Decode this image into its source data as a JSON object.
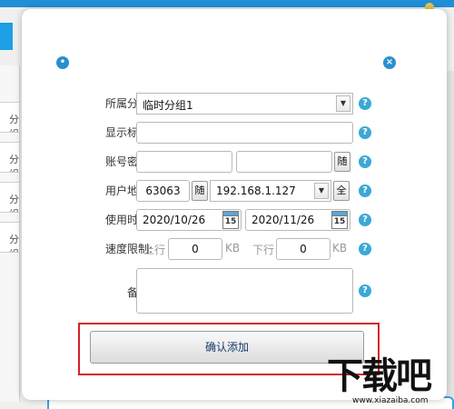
{
  "background": {
    "left_items": [
      "分组",
      "分组",
      "分组",
      "分组"
    ]
  },
  "dialog": {
    "group": {
      "label": "所属分组:",
      "value": "临时分组1"
    },
    "title_field": {
      "label": "显示标题:",
      "value": ""
    },
    "account": {
      "label": "账号密码:",
      "username": "",
      "password": "",
      "random_button": "随"
    },
    "address": {
      "label": "用户地址:",
      "port": "63063",
      "random_button": "随",
      "ip": "192.168.1.127",
      "all_button": "全"
    },
    "time": {
      "label": "使用时间:",
      "start": "2020/10/26",
      "end": "2020/11/26",
      "calendar_num": "15"
    },
    "speed": {
      "label": "速度限制:",
      "up_label": "上行",
      "up_value": "0",
      "up_unit": "KB",
      "down_label": "下行",
      "down_value": "0",
      "down_unit": "KB"
    },
    "remark": {
      "label": "备注:",
      "value": ""
    },
    "help_glyph": "?",
    "confirm_label": "确认添加"
  },
  "watermark": {
    "big": "下载吧",
    "small": "www.xiazaiba.com"
  }
}
